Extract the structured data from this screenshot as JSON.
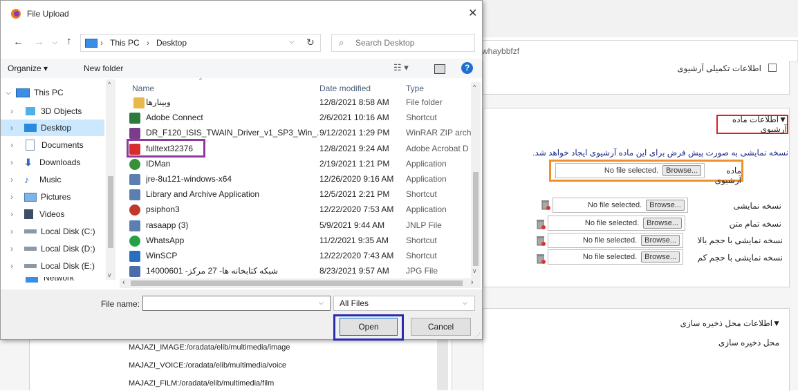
{
  "background": {
    "url_fragment": "whaybbfzf",
    "supplementary_archive_label": "اطلاعات تکمیلی آرشیوی",
    "archive_section_title": "▼اطلاعات ماده آرشیوی",
    "archive_notice": "نسخه نمایشی به صورت پیش فرض برای این ماده آرشیوی ایجاد خواهد شد.",
    "fields": [
      {
        "label": "ماده آرشیوی",
        "status": "No file selected.",
        "button": "Browse..."
      },
      {
        "label": "نسخه نمایشی",
        "status": "No file selected.",
        "button": "Browse..."
      },
      {
        "label": "نسخه تمام متن",
        "status": "No file selected.",
        "button": "Browse..."
      },
      {
        "label": "نسخه نمایشی با حجم بالا",
        "status": "No file selected.",
        "button": "Browse..."
      },
      {
        "label": "نسخه نمایشی با حجم کم",
        "status": "No file selected.",
        "button": "Browse..."
      }
    ],
    "storage_section_title": "▼اطلاعات محل ذخیره سازی",
    "storage_label": "محل ذخیره سازی",
    "storage_paths": [
      "MAJAZI_IMAGE:/oradata/elib/multimedia/image",
      "MAJAZI_VOICE:/oradata/elib/multimedia/voice",
      "MAJAZI_FILM:/oradata/elib/multimedia/film"
    ]
  },
  "dialog": {
    "title": "File Upload",
    "close_glyph": "✕",
    "breadcrumb": [
      "This PC",
      "Desktop"
    ],
    "search_placeholder": "Search Desktop",
    "toolbar": {
      "organize": "Organize ▾",
      "new_folder": "New folder"
    },
    "nav": [
      {
        "label": "This PC",
        "icon": "pc-icon",
        "expanded": true
      },
      {
        "label": "3D Objects",
        "icon": "cube-icon"
      },
      {
        "label": "Desktop",
        "icon": "desktop-icon",
        "selected": true
      },
      {
        "label": "Documents",
        "icon": "document-icon"
      },
      {
        "label": "Downloads",
        "icon": "download-icon"
      },
      {
        "label": "Music",
        "icon": "music-icon"
      },
      {
        "label": "Pictures",
        "icon": "picture-icon"
      },
      {
        "label": "Videos",
        "icon": "video-icon"
      },
      {
        "label": "Local Disk (C:)",
        "icon": "disk-icon"
      },
      {
        "label": "Local Disk (D:)",
        "icon": "disk-icon"
      },
      {
        "label": "Local Disk (E:)",
        "icon": "disk-icon"
      },
      {
        "label": "Network",
        "icon": "network-icon"
      }
    ],
    "columns": {
      "name": "Name",
      "date": "Date modified",
      "type": "Type"
    },
    "files": [
      {
        "name": "وبینارها",
        "date": "12/8/2021 8:58 AM",
        "type": "File folder",
        "icon": "folder-icon",
        "color": "#e8b84a"
      },
      {
        "name": "Adobe Connect",
        "date": "2/6/2021 10:16 AM",
        "type": "Shortcut",
        "icon": "adobe-connect-icon",
        "color": "#2b7a3e"
      },
      {
        "name": "DR_F120_ISIS_TWAIN_Driver_v1_SP3_Win_...",
        "date": "9/12/2021 1:29 PM",
        "type": "WinRAR ZIP archi",
        "icon": "winrar-icon",
        "color": "#7b3c8c"
      },
      {
        "name": "fulltext32376",
        "date": "12/8/2021 9:24 AM",
        "type": "Adobe Acrobat D",
        "icon": "pdf-icon",
        "color": "#d62e2e"
      },
      {
        "name": "IDMan",
        "date": "2/19/2021 1:21 PM",
        "type": "Application",
        "icon": "idm-icon",
        "color": "#3a8f3a"
      },
      {
        "name": "jre-8u121-windows-x64",
        "date": "12/26/2020 9:16 AM",
        "type": "Application",
        "icon": "java-icon",
        "color": "#5a7fb0"
      },
      {
        "name": "Library and Archive Application",
        "date": "12/5/2021 2:21 PM",
        "type": "Shortcut",
        "icon": "java-icon",
        "color": "#5a7fb0"
      },
      {
        "name": "psiphon3",
        "date": "12/22/2020 7:53 AM",
        "type": "Application",
        "icon": "psiphon-icon",
        "color": "#c0392b"
      },
      {
        "name": "rasaapp (3)",
        "date": "5/9/2021 9:44 AM",
        "type": "JNLP File",
        "icon": "java-icon",
        "color": "#5a7fb0"
      },
      {
        "name": "WhatsApp",
        "date": "11/2/2021 9:35 AM",
        "type": "Shortcut",
        "icon": "whatsapp-icon",
        "color": "#25a244"
      },
      {
        "name": "WinSCP",
        "date": "12/22/2020 7:43 AM",
        "type": "Shortcut",
        "icon": "winscp-icon",
        "color": "#2a6fbf"
      },
      {
        "name": "شبکه کتابخانه ها- 27 مرکز- 14000601",
        "date": "8/23/2021 9:57 AM",
        "type": "JPG File",
        "icon": "image-file-icon",
        "color": "#4a6da7"
      }
    ],
    "filename_label": "File name:",
    "filename_value": "",
    "filter": "All Files",
    "open_label": "Open",
    "cancel_label": "Cancel",
    "highlight_colors": {
      "pdf_file": "#8e3a9c",
      "open_button": "#2b2ab0",
      "archive_title": "#e01e1e",
      "archive_field": "#f0902a"
    }
  }
}
